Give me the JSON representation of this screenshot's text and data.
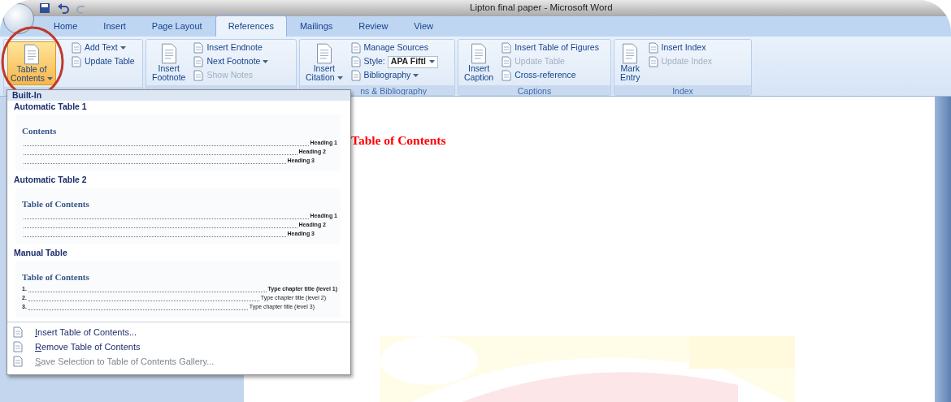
{
  "window": {
    "title": "Lipton final paper - Microsoft Word"
  },
  "tabs": [
    {
      "label": "Home",
      "selected": false
    },
    {
      "label": "Insert",
      "selected": false
    },
    {
      "label": "Page Layout",
      "selected": false
    },
    {
      "label": "References",
      "selected": true
    },
    {
      "label": "Mailings",
      "selected": false
    },
    {
      "label": "Review",
      "selected": false
    },
    {
      "label": "View",
      "selected": false
    }
  ],
  "ribbon": {
    "groups": [
      {
        "items": [
          {
            "kind": "large",
            "lines": [
              "Table of",
              "Contents"
            ],
            "dropdown": true,
            "disabled": false
          },
          {
            "kind": "small",
            "label": "Add Text",
            "dropdown": true,
            "disabled": false
          },
          {
            "kind": "small",
            "label": "Update Table",
            "dropdown": false,
            "disabled": false
          }
        ]
      },
      {
        "items": [
          {
            "kind": "large",
            "lines": [
              "Insert",
              "Footnote"
            ],
            "dropdown": false,
            "disabled": false
          },
          {
            "kind": "small",
            "label": "Insert Endnote",
            "dropdown": false,
            "disabled": false
          },
          {
            "kind": "small",
            "label": "Next Footnote",
            "dropdown": true,
            "disabled": false
          },
          {
            "kind": "small",
            "label": "Show Notes",
            "dropdown": false,
            "disabled": true
          }
        ]
      },
      {
        "label": "ns & Bibliography",
        "items": [
          {
            "kind": "large",
            "lines": [
              "Insert",
              "Citation"
            ],
            "dropdown": true,
            "disabled": false
          },
          {
            "kind": "small",
            "label": "Manage Sources",
            "dropdown": false,
            "disabled": false
          },
          {
            "kind": "combo",
            "label": "Style:",
            "value": "APA Fiftl",
            "dropdown": true,
            "disabled": false
          },
          {
            "kind": "small",
            "label": "Bibliography",
            "dropdown": true,
            "disabled": false
          }
        ]
      },
      {
        "label": "Captions",
        "items": [
          {
            "kind": "large",
            "lines": [
              "Insert",
              "Caption"
            ],
            "dropdown": false,
            "disabled": false
          },
          {
            "kind": "small",
            "label": "Insert Table of Figures",
            "dropdown": false,
            "disabled": false
          },
          {
            "kind": "small",
            "label": "Update Table",
            "dropdown": false,
            "disabled": true
          },
          {
            "kind": "small",
            "label": "Cross-reference",
            "dropdown": false,
            "disabled": false
          }
        ]
      },
      {
        "label": "Index",
        "items": [
          {
            "kind": "large",
            "lines": [
              "Mark",
              "Entry"
            ],
            "dropdown": false,
            "disabled": false
          },
          {
            "kind": "small",
            "label": "Insert Index",
            "dropdown": false,
            "disabled": false
          },
          {
            "kind": "small",
            "label": "Update Index",
            "dropdown": false,
            "disabled": true
          }
        ]
      }
    ]
  },
  "toc_menu": {
    "header": "Built-In",
    "sections": [
      {
        "title": "Automatic Table 1",
        "preview_heading": "Contents",
        "entries": [
          {
            "text": "Heading 1",
            "children": [
              {
                "text": "Heading 2",
                "children": [
                  {
                    "text": "Heading 3"
                  }
                ]
              }
            ]
          }
        ]
      },
      {
        "title": "Automatic Table 2",
        "preview_heading": "Table of Contents",
        "entries": [
          {
            "text": "Heading 1",
            "children": [
              {
                "text": "Heading 2",
                "children": [
                  {
                    "text": "Heading 3"
                  }
                ]
              }
            ]
          }
        ]
      },
      {
        "title": "Manual Table",
        "preview_heading": "Table of Contents",
        "entries": [
          {
            "lead": "1.",
            "text": "Type chapter title (level 1)",
            "children": [
              {
                "lead": "2.",
                "text": "Type chapter title (level 2)",
                "children": [
                  {
                    "lead": "3.",
                    "text": "Type chapter title (level 3)"
                  }
                ]
              }
            ]
          }
        ]
      }
    ],
    "actions": [
      {
        "key": "I",
        "rest": "nsert Table of Contents...",
        "disabled": false
      },
      {
        "key": "R",
        "rest": "emove Table of Contents",
        "disabled": false
      },
      {
        "key": "S",
        "rest": "ave Selection to Table of Contents Gallery...",
        "disabled": true
      }
    ]
  },
  "document": {
    "heading": "Table of Contents"
  }
}
